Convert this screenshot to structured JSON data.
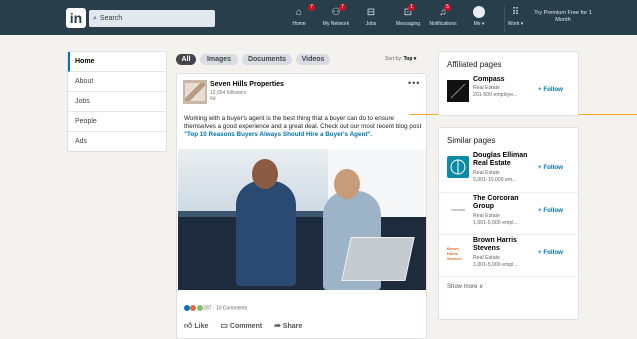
{
  "nav": {
    "logo": "in",
    "search_placeholder": "Search",
    "items": [
      {
        "label": "Home",
        "badge": "7",
        "icon": "home-icon"
      },
      {
        "label": "My Network",
        "badge": "7",
        "icon": "network-icon"
      },
      {
        "label": "Jobs",
        "badge": "",
        "icon": "jobs-icon"
      },
      {
        "label": "Messaging",
        "badge": "1",
        "icon": "messaging-icon"
      },
      {
        "label": "Notifications",
        "badge": "5",
        "icon": "bell-icon"
      },
      {
        "label": "Me ▾",
        "badge": "",
        "icon": "avatar-icon"
      },
      {
        "label": "Work ▾",
        "badge": "",
        "icon": "grid-icon"
      }
    ],
    "premium": "Try Premium Free for 1 Month"
  },
  "leftnav": {
    "items": [
      "Home",
      "About",
      "Jobs",
      "People",
      "Ads"
    ],
    "active": "Home"
  },
  "filters": {
    "pills": [
      "All",
      "Images",
      "Documents",
      "Videos"
    ],
    "active": "All",
    "sort_label": "Sort by:",
    "sort_value": "Top ▾"
  },
  "post": {
    "company": "Seven Hills Properties",
    "followers": "12,054 followers",
    "age": "6d",
    "text": "Working with a buyer's agent is the best thing that a buyer can do to ensure themselves a good experience and a great deal. Check out our most recent blog post ",
    "link": "\"Top 10 Reasons Buyers Always Should Hire a Buyer's Agent\".",
    "reactions": "287 · 10 Comments",
    "actions": {
      "like": "Like",
      "comment": "Comment",
      "share": "Share"
    },
    "reaction_colors": [
      "#0073b1",
      "#e06847",
      "#7fc15e"
    ]
  },
  "affiliated": {
    "title": "Affiliated pages",
    "items": [
      {
        "name": "Compass",
        "industry": "Real Estate",
        "size": "201-500 employe...",
        "follow": "+ Follow"
      }
    ]
  },
  "similar": {
    "title": "Similar pages",
    "items": [
      {
        "name": "Douglas Elliman Real Estate",
        "industry": "Real Estate",
        "size": "5,001-10,000 em...",
        "follow": "+ Follow"
      },
      {
        "name": "The Corcoran Group",
        "industry": "Real Estate",
        "size": "1,001-5,000 empl...",
        "follow": "+ Follow",
        "logo_text": "corcoran"
      },
      {
        "name": "Brown Harris Stevens",
        "industry": "Real Estate",
        "size": "1,001-5,000 empl...",
        "follow": "+ Follow",
        "logo_text": "Brown Harris Stevens"
      }
    ],
    "show_more": "Show more ∨"
  }
}
